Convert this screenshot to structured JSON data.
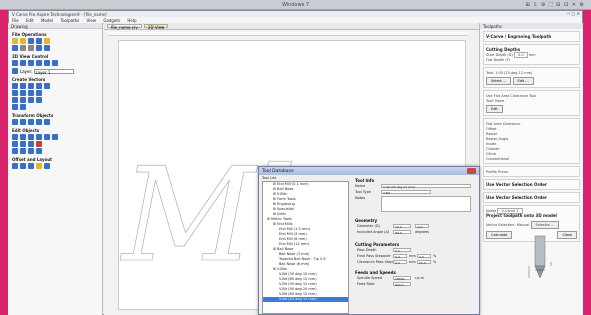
{
  "vm": {
    "title": "Windows 7",
    "icons": "⊞ ⇩ ⚙ ⛶ ⊟ ⊡ ✕ ⚙"
  },
  "app": {
    "title": "V Carve Pro Aspire Technologies® - [file_name]",
    "controls": "— ▢ ✕"
  },
  "menu": [
    "File",
    "Edit",
    "Model",
    "Toolpaths",
    "View",
    "Gadgets",
    "Help"
  ],
  "left_panel": {
    "header": "Drawing",
    "sections": [
      "File Operations",
      "2D View Control",
      "Create Vectors",
      "Transform Objects",
      "Edit Objects",
      "Offset and Layout"
    ],
    "layer_label": "Layer:",
    "layer_value": "Layer 1"
  },
  "tabs": [
    {
      "label": "file_name.crv"
    },
    {
      "label": "2D View"
    }
  ],
  "canvas": {
    "lettering": "Mb"
  },
  "right_panel": {
    "header": "Toolpaths",
    "title": "V-Carve / Engraving Toolpath",
    "cutting_depths": "Cutting Depths",
    "start_depth_label": "Start Depth (D)",
    "start_depth_value": "0.0",
    "start_depth_unit": "mm",
    "flat_depth_label": "Flat Depth (F)",
    "tool_label": "Tool: 1.00 (25 deg 12 mm)",
    "select_btn": "Select ...",
    "edit_btn": "Edit ...",
    "flat_area_label": "Use Flat Area Clearance Tool",
    "flat_area_tool": "Tool: None",
    "edit_btn2": "Edit",
    "allowance_label": "Flat Area Clearance",
    "offset_label": "Offset",
    "raster_label": "Raster",
    "raster_angle": "Raster Angle",
    "inside_label": "Inside",
    "outside_label": "Outside",
    "climb_label": "Climb",
    "conventional_label": "Conventional",
    "more_label": "Profile Prime",
    "vector_selection": "Use Vector Selection Order",
    "vector_selection2": "Use Vector Selection Order",
    "name_label": "Name",
    "name_value": "V-Carve 1",
    "project_label": "Project toolpath onto 3D model",
    "vector_select_label": "Vector Selection:",
    "vector_select_value": "Manual",
    "selector_btn": "Selector ...",
    "calculate_btn": "Calculate",
    "close_btn": "Close"
  },
  "dialog": {
    "title": "Tool Database",
    "tool_list_label": "Tool List",
    "tools": [
      "End Mill (0.1 inch)",
      "Ball Nose",
      "V-Bits",
      "Form Tools",
      "Engraving",
      "Specialist",
      "Drills",
      "Metric Tools",
      "End Mills",
      "End Mill (1.5 mm)",
      "End Mill (3 mm)",
      "End Mill (6 mm)",
      "End Mill (12 mm)",
      "Ball Nose",
      "Ball Nose (3 mm)",
      "Tapered Ball Nose - Tip 0.5",
      "Ball Nose (6 mm)",
      "V-Bits",
      "V-Bit (30 deg 10 mm)",
      "V-Bit (60 deg 12 mm)",
      "V-Bit (90 deg 12 mm)",
      "V-Bit (90 deg 20 mm)",
      "V-Bit (60 deg 12 mm)",
      "V-Bit (25 deg 12 mm)"
    ],
    "selected_index": 23,
    "tool_info": "Tool Info",
    "name_label": "Name",
    "name_value": "1.00 (25 deg 12 mm)",
    "tool_type_label": "Tool Type",
    "tool_type_value": "V-Bit",
    "notes_label": "Notes",
    "geometry": "Geometry",
    "diameter_label": "Diameter (D)",
    "diameter_value": "12.0",
    "diameter_unit": "mm",
    "angle_label": "Included Angle (A)",
    "angle_value": "90.0",
    "angle_unit": "degrees",
    "cutting_params": "Cutting Parameters",
    "pass_depth_label": "Pass Depth",
    "pass_depth_value": "3.0",
    "stepover_label": "Final Pass Stepover",
    "stepover_value": "0.4",
    "stepover_unit": "mm",
    "stepover_pct": "3.3",
    "clear_stepover_label": "Clearance Pass Stepover",
    "clear_stepover_value": "0.4",
    "clear_stepover_pct": "20.0",
    "pct": "%",
    "feeds_speeds": "Feeds and Speeds",
    "spindle_label": "Spindle Speed",
    "spindle_value": "18000",
    "spindle_unit": "r.p.m",
    "feed_label": "Feed Rate",
    "feed_value": "800.0"
  }
}
